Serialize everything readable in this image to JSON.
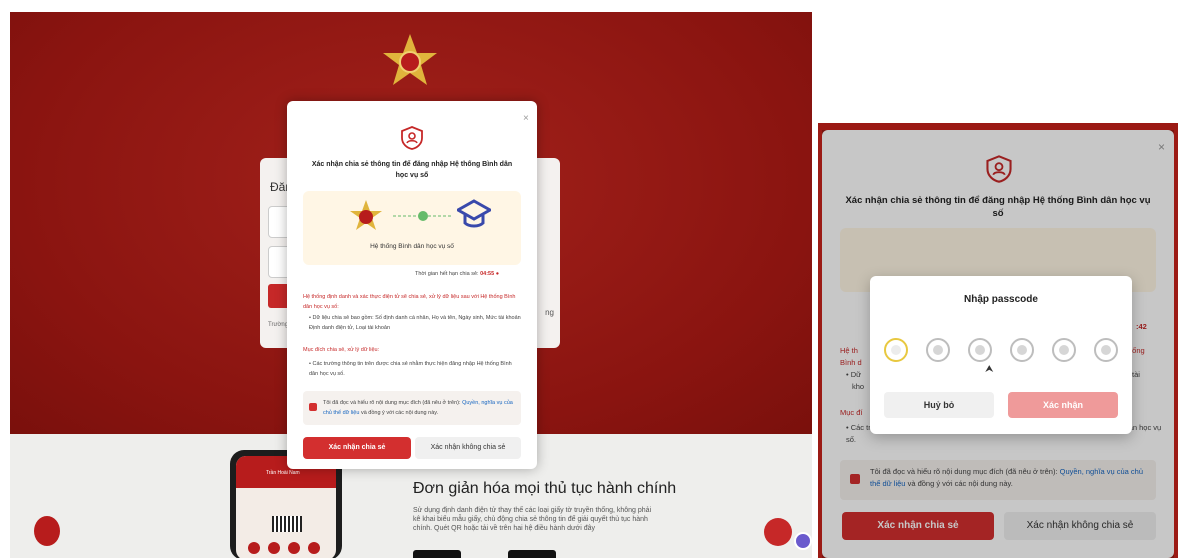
{
  "left": {
    "login_heading": "Đăn",
    "login_footer": "Trường",
    "login_side": "ng",
    "bottom": {
      "title": "Đơn giản hóa mọi thủ tục hành chính",
      "description": "Sử dụng định danh điện tử thay thế các loại giấy tờ truyền thống, không phải kê khai biểu mẫu giấy, chủ động chia sẻ thông tin để giải quyết thủ tục hành chính. Quét QR hoặc tải về trên hai hệ điều hành dưới đây",
      "phone_user": "Trần Hoài Nam"
    }
  },
  "dialog": {
    "close": "×",
    "title": "Xác nhận chia sẻ thông tin để đăng nhập Hệ thống Bình dân học vụ số",
    "system_name": "Hệ thống Bình dân học vụ số",
    "expiry_label": "Thời gian hết hạn chia sẻ:",
    "expiry_left": "04:55",
    "expiry_right": ":42",
    "section1_heading": "Hệ thống định danh và xác thực điện tử sẽ chia sẻ, xử lý dữ liệu sau với Hệ thống Bình dân học vụ số:",
    "section1_item": "Dữ liệu chia sẻ bao gồm: Số định danh cá nhân, Họ và tên, Ngày sinh, Mức tài khoản Định danh điện tử, Loại tài khoản",
    "section2_heading": "Mục đích chia sẻ, xử lý dữ liệu:",
    "section2_item": "Các trường thông tin trên được chia sẻ nhằm thực hiện đăng nhập Hệ thống Bình dân học vụ số.",
    "agree_prefix": "Tôi đã đọc và hiểu rõ nội dung mục đích (đã nêu ở trên):",
    "agree_link": "Quyền, nghĩa vụ của chủ thể dữ liệu",
    "agree_suffix": "và đồng ý với các nội dung này.",
    "confirm_button": "Xác nhận chia sẻ",
    "decline_button": "Xác nhận không chia sẻ"
  },
  "right": {
    "peek_heading": "Hệ th",
    "peek_heading_right": "hống",
    "peek_sub": "Bình d",
    "peek_item": "Dữ",
    "peek_item_right": "tài",
    "peek_item2": "kho",
    "peek_purpose": "Mục đí",
    "passcode": {
      "title": "Nhập passcode",
      "cancel": "Huỷ bỏ",
      "confirm": "Xác nhận",
      "digits": 6
    }
  },
  "colors": {
    "brand_red": "#d32f2f",
    "background_red": "#8f1712",
    "link_blue": "#1565c0",
    "confirm_disabled": "#ef9a9a"
  }
}
